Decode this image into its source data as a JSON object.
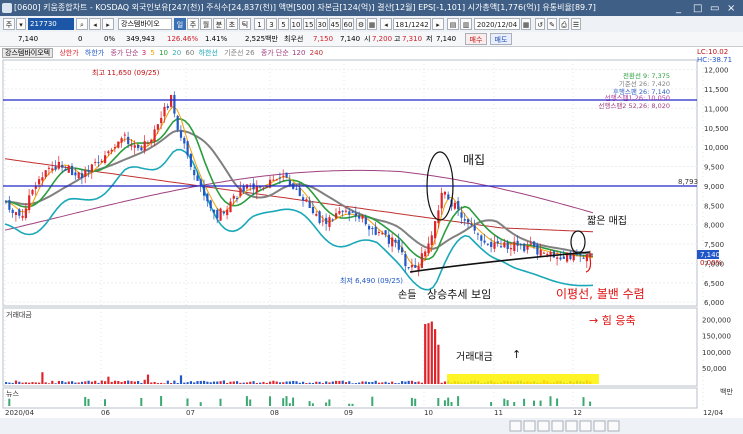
{
  "window": {
    "title": "[0600] 키움종합차트 - KOSDAQ 외국인보유[247(천)] 주식수[24,837(천)] 액면[500] 자본금[124(억)] 결산[12월] EPS[-1,101] 시가총액[1,776(억)] 유통비율[89.7]"
  },
  "toolbar": {
    "menu_button": "주",
    "code": "217730",
    "stock_name": "강스템바이오",
    "period_buttons": [
      "일",
      "주",
      "월",
      "분",
      "초",
      "틱"
    ],
    "minute_buttons": [
      "1",
      "3",
      "5",
      "10",
      "15",
      "30",
      "45",
      "60"
    ],
    "count_label": "181/1242",
    "date": "2020/12/04"
  },
  "quote": {
    "price": "7,140",
    "change": "0",
    "change_pct": "0%",
    "volume": "349,943",
    "volume_pct": "126.46%",
    "turnover_pct": "1.41%",
    "amount": "2,525백만",
    "preferred_label": "최우선",
    "preferred": "7,150",
    "current": "7,140",
    "open_label": "시",
    "open": "7,200",
    "high_label": "고",
    "high": "7,310",
    "low_label": "저",
    "low": "7,140",
    "buy_button": "매수",
    "sell_button": "매도"
  },
  "legend": {
    "name": "강스템바이오텍",
    "upper": "상한가",
    "lower": "하한가",
    "ma_label": "종가 단순",
    "ma3": "3",
    "ma5": "5",
    "ma10": "10",
    "ma20": "20",
    "ma60": "60",
    "lower_line": "하한선",
    "base_line": "기준선 26",
    "ma_label2": "종가 단순",
    "ma120": "120",
    "ma240": "240"
  },
  "indicators": {
    "lc": "LC:10.02",
    "hc": "HC:-38.71",
    "conv": "전환선 9: 7,375",
    "base": "기준선 26: 7,420",
    "lag": "후행스팬 26: 7,140",
    "lead1": "선행스팬1 26: 10,050",
    "lead2": "선행스팬2 52,26: 8,020"
  },
  "annotations": {
    "high": "최고 11,650 (09/25)",
    "low": "최저 6,490 (09/25)",
    "line_8793": "8,793",
    "line_10950": "10,950",
    "price_tag": "7,140",
    "pct_tag": "0.00%",
    "hand1": "매집",
    "hand2": "짧은 매집",
    "hand3": "손들",
    "hand4": "상승추세 보임",
    "hand5": "이평선, 볼밴 수렴",
    "hand6": "→ 힘 응축",
    "hand7": "거래대금",
    "hand8": "↑"
  },
  "y_axis": [
    "12,000",
    "11,500",
    "11,000",
    "10,500",
    "10,000",
    "9,500",
    "9,000",
    "8,500",
    "8,000",
    "7,500",
    "7,000",
    "6,500",
    "6,000"
  ],
  "volume_panel": {
    "title": "거래대금",
    "y_axis": [
      "200,000",
      "150,000",
      "100,000",
      "50,000"
    ],
    "unit": "백만"
  },
  "news_panel": {
    "title": "뉴스"
  },
  "x_axis": [
    "2020/04",
    "06",
    "07",
    "08",
    "09",
    "10",
    "11",
    "12",
    "12/04"
  ],
  "colors": {
    "up": "#e0242b",
    "down": "#2157c7",
    "ma5": "#f0a000",
    "ma20": "#2a9d3c",
    "bollinger": "#1aa8b8",
    "kijun": "#808080",
    "ma120": "#a04080",
    "ma240": "#c03030"
  }
}
